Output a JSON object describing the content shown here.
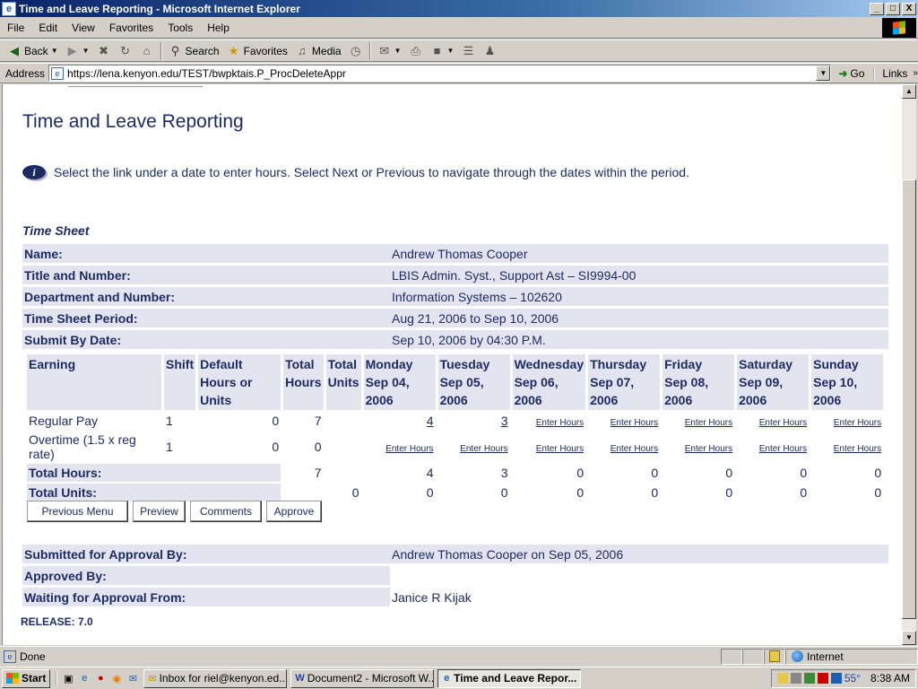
{
  "window": {
    "title": "Time and Leave Reporting - Microsoft Internet Explorer",
    "controls": [
      "_",
      "□",
      "X"
    ]
  },
  "menu": [
    "File",
    "Edit",
    "View",
    "Favorites",
    "Tools",
    "Help"
  ],
  "toolbar": {
    "back": "Back",
    "search": "Search",
    "favorites": "Favorites",
    "media": "Media"
  },
  "address": {
    "label": "Address",
    "url": "https://lena.kenyon.edu/TEST/bwpktais.P_ProcDeleteAppr",
    "go": "Go",
    "links": "Links"
  },
  "page": {
    "title": "Time and Leave Reporting",
    "info": "Select the link under a date to enter hours. Select Next or Previous to navigate through the dates within the period.",
    "section": "Time Sheet",
    "details": [
      {
        "label": "Name:",
        "value": "Andrew Thomas Cooper"
      },
      {
        "label": "Title and Number:",
        "value": "LBIS Admin. Syst., Support Ast – SI9994-00"
      },
      {
        "label": "Department and Number:",
        "value": "Information Systems – 102620"
      },
      {
        "label": "Time Sheet Period:",
        "value": "Aug 21, 2006 to Sep 10, 2006"
      },
      {
        "label": "Submit By Date:",
        "value": "Sep 10, 2006 by 04:30 P.M."
      }
    ],
    "grid": {
      "headers": [
        [
          "Earning",
          ""
        ],
        [
          "Shift",
          ""
        ],
        [
          "Default",
          "Hours or Units"
        ],
        [
          "Total",
          "Hours"
        ],
        [
          "Total",
          "Units"
        ],
        [
          "Monday",
          "Sep 04, 2006"
        ],
        [
          "Tuesday",
          "Sep 05, 2006"
        ],
        [
          "Wednesday",
          "Sep 06, 2006"
        ],
        [
          "Thursday",
          "Sep 07, 2006"
        ],
        [
          "Friday",
          "Sep 08, 2006"
        ],
        [
          "Saturday",
          "Sep 09, 2006"
        ],
        [
          "Sunday",
          "Sep 10, 2006"
        ]
      ],
      "rows": [
        {
          "earning": "Regular Pay",
          "shift": "1",
          "default": "0",
          "total_hours": "7",
          "total_units": "",
          "days": [
            "4",
            "3",
            "Enter Hours",
            "Enter Hours",
            "Enter Hours",
            "Enter Hours",
            "Enter Hours"
          ]
        },
        {
          "earning": "Overtime (1.5 x reg rate)",
          "shift": "1",
          "default": "0",
          "total_hours": "0",
          "total_units": "",
          "days": [
            "Enter Hours",
            "Enter Hours",
            "Enter Hours",
            "Enter Hours",
            "Enter Hours",
            "Enter Hours",
            "Enter Hours"
          ]
        }
      ],
      "total_hours": {
        "label": "Total Hours:",
        "total": "7",
        "days": [
          "4",
          "3",
          "0",
          "0",
          "0",
          "0",
          "0"
        ]
      },
      "total_units": {
        "label": "Total Units:",
        "total": "0",
        "days": [
          "0",
          "0",
          "0",
          "0",
          "0",
          "0",
          "0"
        ]
      }
    },
    "buttons": [
      "Previous Menu",
      "Preview",
      "Comments",
      "Approve"
    ],
    "approval": [
      {
        "label": "Submitted for Approval By:",
        "value": "Andrew Thomas Cooper on Sep 05, 2006"
      },
      {
        "label": "Approved By:",
        "value": ""
      },
      {
        "label": "Waiting for Approval From:",
        "value": "Janice R Kijak"
      }
    ],
    "release": "RELEASE: 7.0"
  },
  "status": {
    "text": "Done",
    "zone": "Internet"
  },
  "taskbar": {
    "start": "Start",
    "tasks": [
      "Inbox for riel@kenyon.ed...",
      "Document2 - Microsoft W...",
      "Time and Leave Repor..."
    ],
    "temperature": "55°",
    "clock": "8:38 AM"
  }
}
